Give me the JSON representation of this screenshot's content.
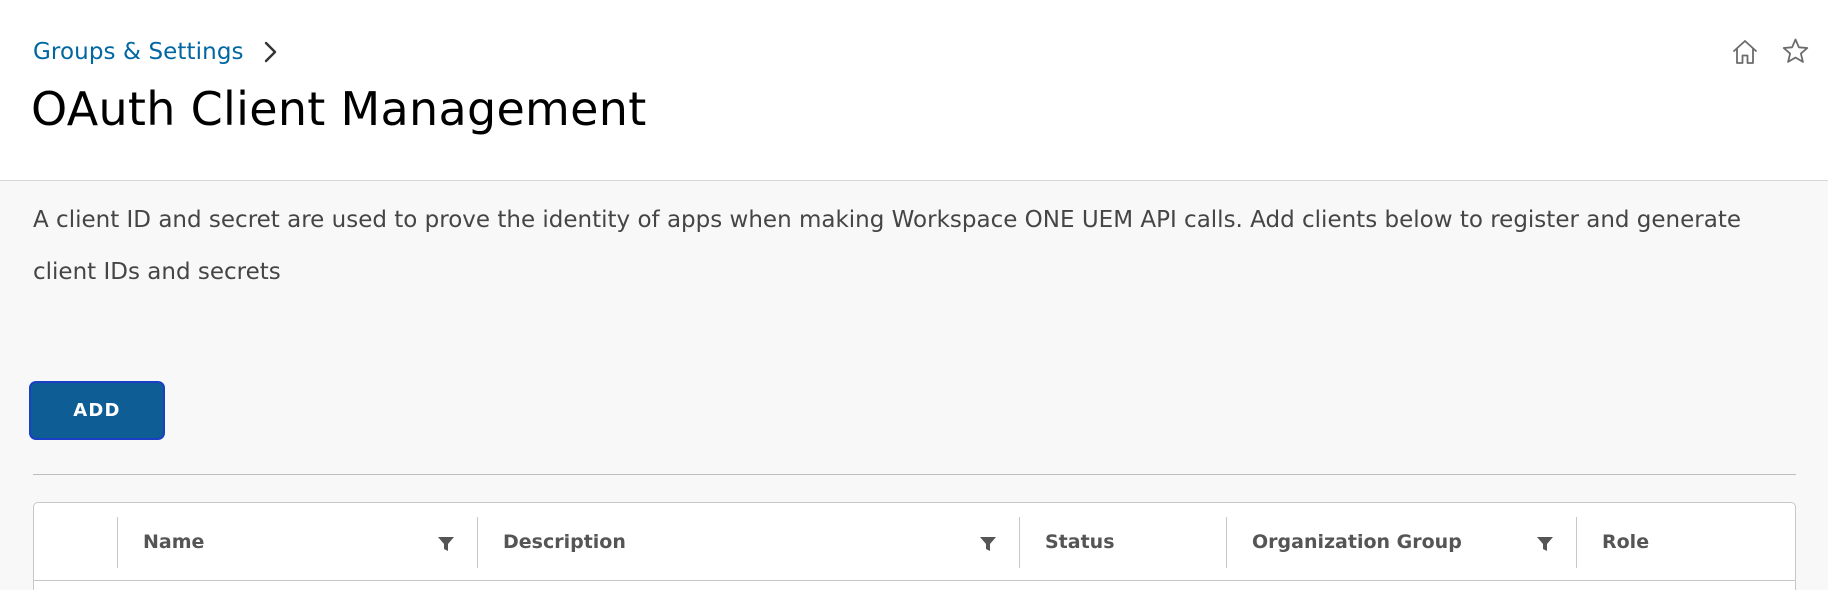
{
  "breadcrumb": {
    "label": "Groups & Settings"
  },
  "page": {
    "title": "OAuth Client Management"
  },
  "description": "A client ID and secret are used to prove the identity of apps when making Workspace ONE UEM API calls. Add clients below to register and generate client IDs and secrets",
  "toolbar": {
    "add_label": "ADD"
  },
  "table": {
    "columns": [
      {
        "label": "Name",
        "filterable": true
      },
      {
        "label": "Description",
        "filterable": true
      },
      {
        "label": "Status",
        "filterable": false
      },
      {
        "label": "Organization Group",
        "filterable": true
      },
      {
        "label": "Role",
        "filterable": false
      }
    ]
  },
  "icons": {
    "home": "home-icon",
    "favorite": "star-icon",
    "breadcrumb_chevron": "chevron-right-icon",
    "filter": "filter-icon"
  },
  "colors": {
    "link": "#0067a3",
    "primary_button": "#0e5e95",
    "button_focus_ring": "#1a3fc4"
  }
}
